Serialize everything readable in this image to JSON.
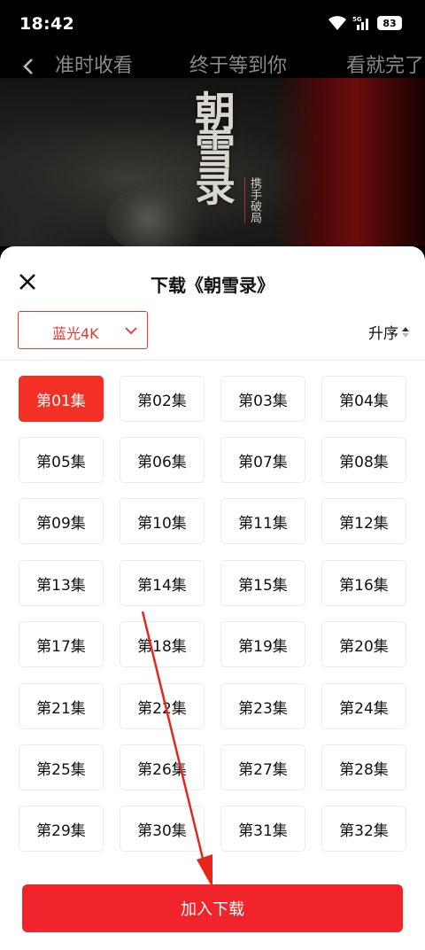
{
  "status_bar": {
    "time": "18:42",
    "network_badge": "5G",
    "battery": "83"
  },
  "top_nav": {
    "tabs": [
      "准时收看",
      "终于等到你",
      "看就完了"
    ]
  },
  "banner": {
    "title": "朝雪录",
    "subtitle": "携手破局"
  },
  "sheet": {
    "title": "下载《朝雪录》",
    "quality_label": "蓝光4K",
    "sort_label": "升序",
    "episodes": [
      "第01集",
      "第02集",
      "第03集",
      "第04集",
      "第05集",
      "第06集",
      "第07集",
      "第08集",
      "第09集",
      "第10集",
      "第11集",
      "第12集",
      "第13集",
      "第14集",
      "第15集",
      "第16集",
      "第17集",
      "第18集",
      "第19集",
      "第20集",
      "第21集",
      "第22集",
      "第23集",
      "第24集",
      "第25集",
      "第26集",
      "第27集",
      "第28集",
      "第29集",
      "第30集",
      "第31集",
      "第32集"
    ],
    "selected_episode": "第01集",
    "add_button_label": "加入下载"
  },
  "colors": {
    "accent": "#f23026",
    "button": "#f2242b"
  }
}
